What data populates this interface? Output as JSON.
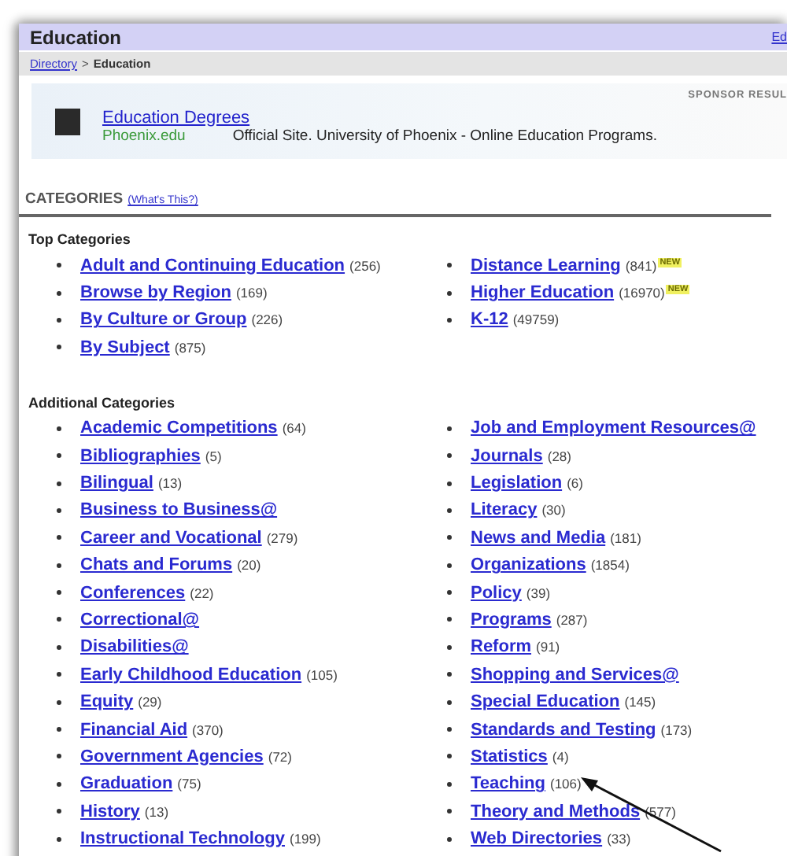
{
  "header": {
    "title": "Education",
    "link": "Ed"
  },
  "breadcrumb": {
    "link": "Directory",
    "separator": ">",
    "current": "Education"
  },
  "sponsor": {
    "label": "SPONSOR RESUL",
    "title": "Education Degrees",
    "site": "Phoenix.edu",
    "description": "Official Site. University of Phoenix - Online Education Programs."
  },
  "categories": {
    "heading": "CATEGORIES",
    "help_link": "(What's This?)"
  },
  "sections": [
    {
      "title": "Top Categories",
      "columns": [
        [
          {
            "name": "Adult and Continuing Education",
            "count": "(256)"
          },
          {
            "name": "Browse by Region",
            "count": "(169)"
          },
          {
            "name": "By Culture or Group",
            "count": "(226)"
          },
          {
            "name": "By Subject",
            "count": "(875)"
          }
        ],
        [
          {
            "name": "Distance Learning",
            "count": "(841)",
            "badge": "NEW"
          },
          {
            "name": "Higher Education",
            "count": "(16970)",
            "badge": "NEW"
          },
          {
            "name": "K-12",
            "count": "(49759)"
          }
        ]
      ]
    },
    {
      "title": "Additional Categories",
      "columns": [
        [
          {
            "name": "Academic Competitions",
            "count": "(64)"
          },
          {
            "name": "Bibliographies",
            "count": "(5)"
          },
          {
            "name": "Bilingual",
            "count": "(13)"
          },
          {
            "name": "Business to Business@"
          },
          {
            "name": "Career and Vocational",
            "count": "(279)"
          },
          {
            "name": "Chats and Forums",
            "count": "(20)"
          },
          {
            "name": "Conferences",
            "count": "(22)"
          },
          {
            "name": "Correctional@"
          },
          {
            "name": "Disabilities@"
          },
          {
            "name": "Early Childhood Education",
            "count": "(105)"
          },
          {
            "name": "Equity",
            "count": "(29)"
          },
          {
            "name": "Financial Aid",
            "count": "(370)"
          },
          {
            "name": "Government Agencies",
            "count": "(72)"
          },
          {
            "name": "Graduation",
            "count": "(75)"
          },
          {
            "name": "History",
            "count": "(13)"
          },
          {
            "name": "Instructional Technology",
            "count": "(199)"
          }
        ],
        [
          {
            "name": "Job and Employment Resources@"
          },
          {
            "name": "Journals",
            "count": "(28)"
          },
          {
            "name": "Legislation",
            "count": "(6)"
          },
          {
            "name": "Literacy",
            "count": "(30)"
          },
          {
            "name": "News and Media",
            "count": "(181)"
          },
          {
            "name": "Organizations",
            "count": "(1854)"
          },
          {
            "name": "Policy",
            "count": "(39)"
          },
          {
            "name": "Programs",
            "count": "(287)"
          },
          {
            "name": "Reform",
            "count": "(91)"
          },
          {
            "name": "Shopping and Services@"
          },
          {
            "name": "Special Education",
            "count": "(145)"
          },
          {
            "name": "Standards and Testing",
            "count": "(173)"
          },
          {
            "name": "Statistics",
            "count": "(4)"
          },
          {
            "name": "Teaching",
            "count": "(106)"
          },
          {
            "name": "Theory and Methods",
            "count": "(577)"
          },
          {
            "name": "Web Directories",
            "count": "(33)"
          }
        ]
      ]
    }
  ]
}
